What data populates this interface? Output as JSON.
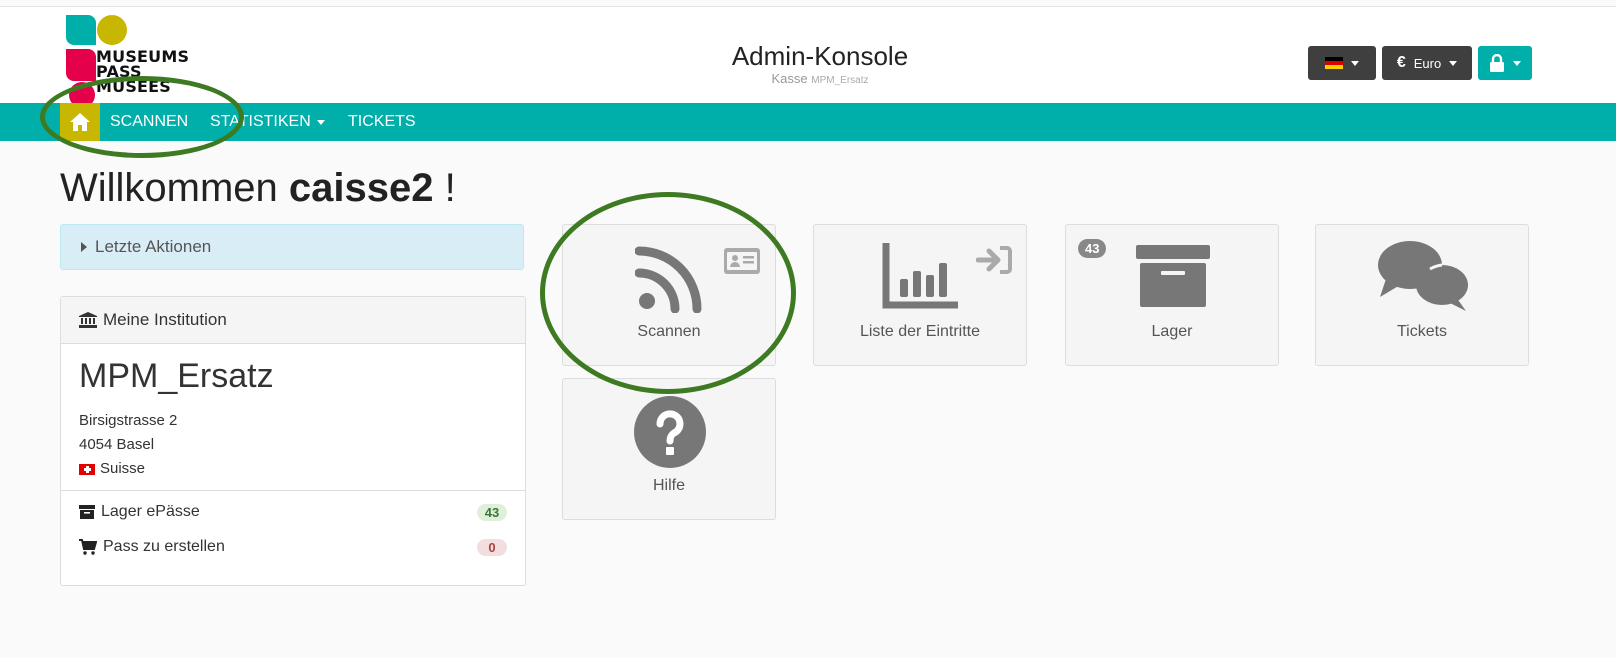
{
  "header": {
    "logo": {
      "line1": "MUSEUMS",
      "line2": "PASS",
      "line3": "MUSEES",
      "colors": [
        "#00aeaa",
        "#c8b700",
        "#e5004b",
        "#e5004b"
      ]
    },
    "title": "Admin-Konsole",
    "subtitle_prefix": "Kasse",
    "subtitle_small": "MPM_Ersatz",
    "currency_symbol": "€",
    "currency_label": "Euro",
    "language_flag": "flag-de-icon",
    "lock_icon": "lock-icon"
  },
  "nav": {
    "home_icon": "home-icon",
    "items": [
      {
        "label": "SCANNEN"
      },
      {
        "label": "STATISTIKEN"
      },
      {
        "label": "TICKETS"
      }
    ],
    "accent": "#00aeaa",
    "home_color": "#c8b700"
  },
  "welcome": {
    "prefix": "Willkommen",
    "user": "caisse2",
    "suffix": "!"
  },
  "actions": {
    "label": "Letzte Aktionen"
  },
  "institution": {
    "header": "Meine Institution",
    "name": "MPM_Ersatz",
    "street": "Birsigstrasse 2",
    "city": "4054 Basel",
    "country": "Suisse",
    "stats": [
      {
        "label": "Lager ePässe",
        "count": "43",
        "icon": "archive-icon"
      },
      {
        "label": "Pass zu erstellen",
        "count": "0",
        "icon": "cart-icon"
      }
    ]
  },
  "tiles": [
    {
      "label": "Scannen",
      "icon": "rss-icon"
    },
    {
      "label": "Liste der Eintritte",
      "icon": "bar-chart-icon"
    },
    {
      "label": "Lager",
      "icon": "archive-icon",
      "badge": "43"
    },
    {
      "label": "Tickets",
      "icon": "comments-icon"
    },
    {
      "label": "Hilfe",
      "icon": "question-icon"
    }
  ],
  "annotation_color": "#3d7a22"
}
